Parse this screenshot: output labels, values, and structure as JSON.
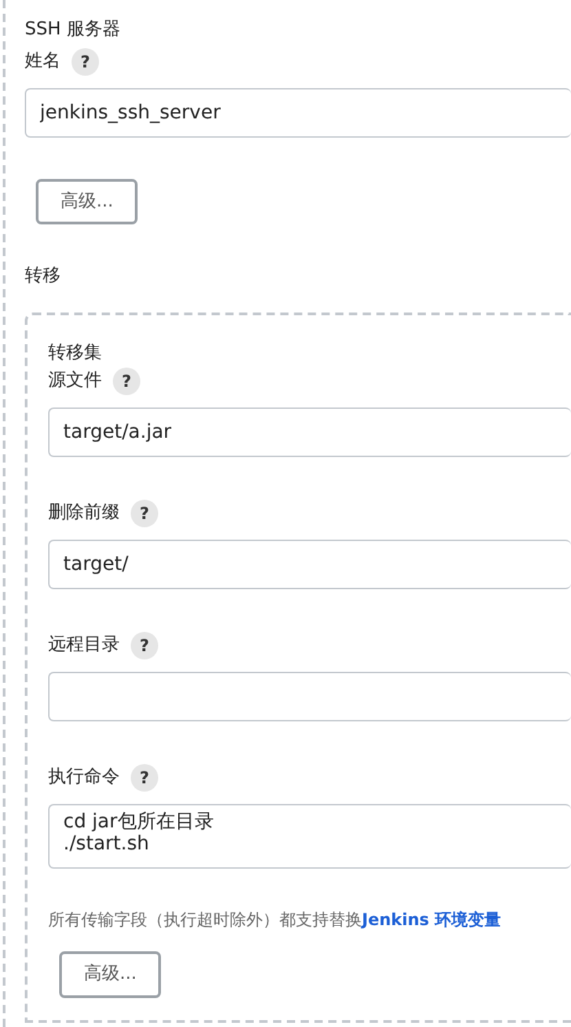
{
  "ssh_server": {
    "title": "SSH 服务器",
    "name_field": {
      "label": "姓名",
      "help": "?",
      "value": "jenkins_ssh_server"
    },
    "advanced_button": "高级..."
  },
  "transfer": {
    "title": "转移",
    "transfer_set": {
      "title": "转移集",
      "fields": [
        {
          "kind": "input",
          "label": "源文件",
          "help": "?",
          "value": "target/a.jar"
        },
        {
          "kind": "input",
          "label": "删除前缀",
          "help": "?",
          "value": "target/"
        },
        {
          "kind": "input",
          "label": "远程目录",
          "help": "?"
        },
        {
          "kind": "textarea",
          "label": "执行命令",
          "help": "?",
          "value": "cd jar包所在目录\n./start.sh"
        }
      ],
      "note": {
        "text": "所有传输字段（执行超时除外）都支持替换",
        "link": "Jenkins 环境变量"
      },
      "advanced_button": "高级..."
    }
  }
}
